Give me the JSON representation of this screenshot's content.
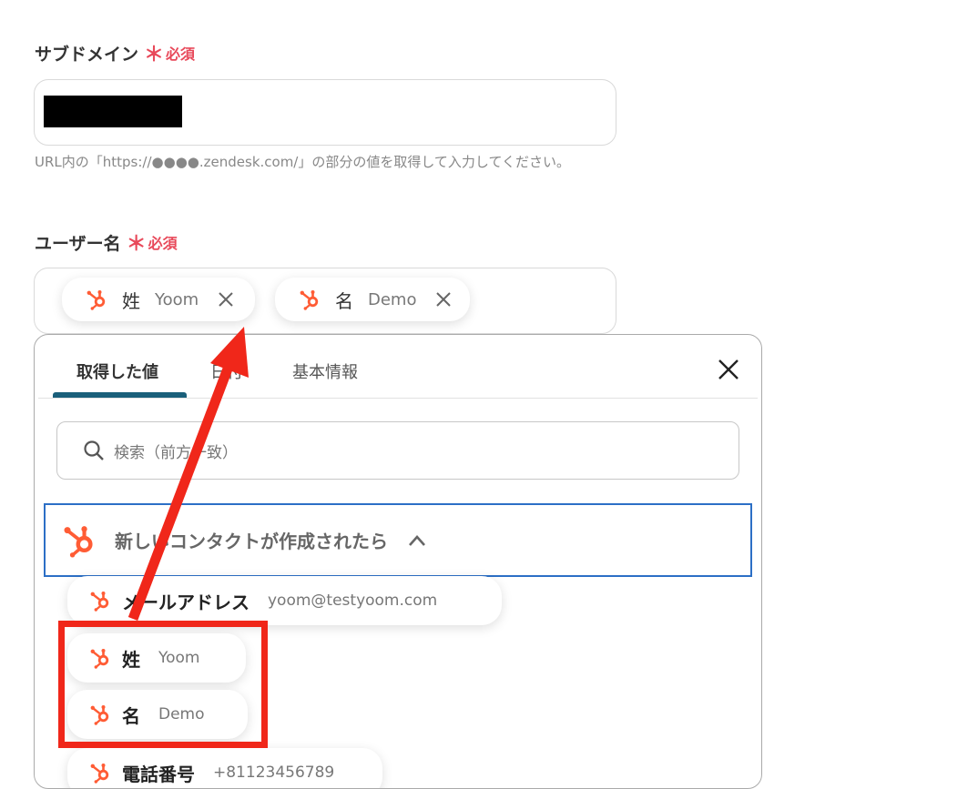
{
  "subdomain": {
    "label": "サブドメイン",
    "required_mark": "＊",
    "required_text": "必須",
    "hint": "URL内の「https://●●●●.zendesk.com/」の部分の値を取得して入力してください。"
  },
  "username": {
    "label": "ユーザー名",
    "required_mark": "＊",
    "required_text": "必須",
    "chips": [
      {
        "name": "姓",
        "value": "Yoom"
      },
      {
        "name": "名",
        "value": "Demo"
      }
    ]
  },
  "popup": {
    "tabs": [
      {
        "label": "取得した値",
        "active": true
      },
      {
        "label": "日付",
        "active": false
      },
      {
        "label": "基本情報",
        "active": false
      }
    ],
    "search_placeholder": "検索（前方一致）",
    "group_title": "新しいコンタクトが作成されたら",
    "items": [
      {
        "name": "メールアドレス",
        "value": "yoom@testyoom.com"
      },
      {
        "name": "姓",
        "value": "Yoom"
      },
      {
        "name": "名",
        "value": "Demo"
      },
      {
        "name": "電話番号",
        "value": "+81123456789"
      }
    ]
  },
  "colors": {
    "required": "#e8495a",
    "hubspot": "#ff5c35",
    "tab_underline": "#1a5f7a",
    "group_border": "#2c6fc6",
    "annotation": "#f0271a"
  }
}
